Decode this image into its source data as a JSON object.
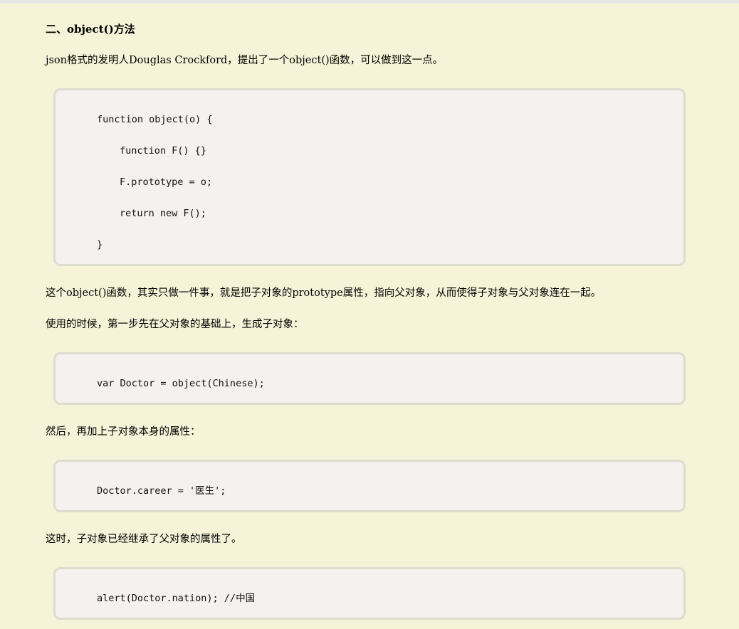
{
  "section": {
    "heading": "二、object()方法"
  },
  "paragraphs": {
    "p1": "json格式的发明人Douglas Crockford，提出了一个object()函数，可以做到这一点。",
    "p2": "这个object()函数，其实只做一件事，就是把子对象的prototype属性，指向父对象，从而使得子对象与父对象连在一起。",
    "p3": "使用的时候，第一步先在父对象的基础上，生成子对象：",
    "p4": "然后，再加上子对象本身的属性：",
    "p5": "这时，子对象已经继承了父对象的属性了。"
  },
  "code": {
    "block1": [
      "function object(o) {",
      "function F() {}",
      "F.prototype = o;",
      "return new F();",
      "}"
    ],
    "block2": [
      "var Doctor = object(Chinese);"
    ],
    "block3": [
      "Doctor.career = '医生';"
    ],
    "block4": [
      "alert(Doctor.nation); //中国"
    ]
  }
}
